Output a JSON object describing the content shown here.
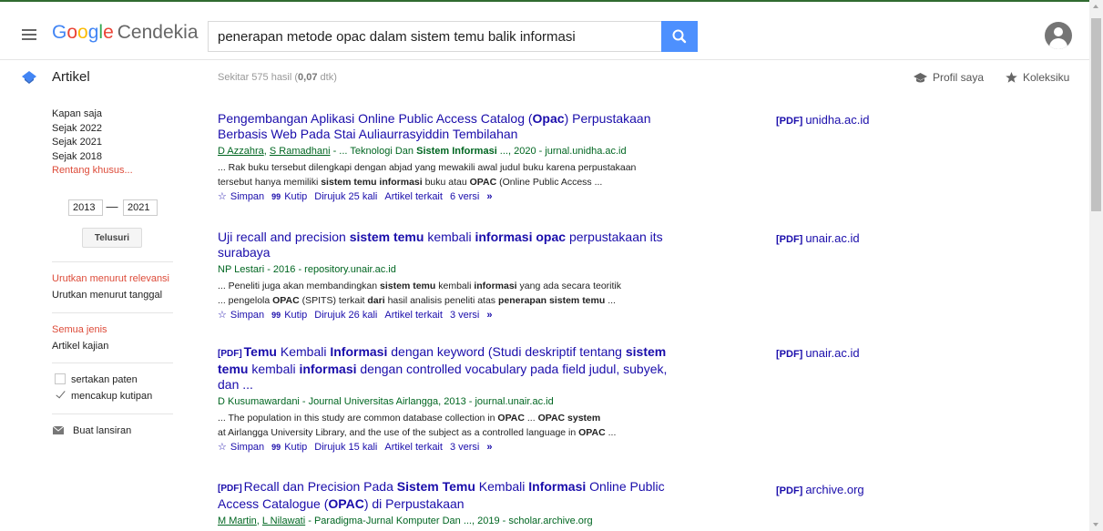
{
  "header": {
    "logo_google": "Google",
    "logo_suffix": "Cendekia",
    "search_value": "penerapan metode opac dalam sistem temu balik informasi"
  },
  "subbar": {
    "section_label": "Artikel",
    "stats_pre": "Sekitar 575 hasil (",
    "stats_time": "0,07",
    "stats_post": " dtk)",
    "profile_label": "Profil saya",
    "library_label": "Koleksiku"
  },
  "sidebar": {
    "time_filters": [
      "Kapan saja",
      "Sejak 2022",
      "Sejak 2021",
      "Sejak 2018",
      "Rentang khusus..."
    ],
    "year_from": "2013",
    "year_to": "2021",
    "range_dash": "—",
    "search_button": "Telusuri",
    "sort_relevance": "Urutkan menurut relevansi",
    "sort_date": "Urutkan menurut tanggal",
    "type_all": "Semua jenis",
    "type_review": "Artikel kajian",
    "include_patents": "sertakan paten",
    "include_citations": "mencakup kutipan",
    "create_alert": "Buat lansiran"
  },
  "common": {
    "pdf_tag": "[PDF]",
    "save": "Simpan",
    "cite": "Kutip",
    "related": "Artikel terkait"
  },
  "results": [
    {
      "title_parts": [
        {
          "t": "Pengembangan Aplikasi Online Public Access Catalog (",
          "b": false
        },
        {
          "t": "Opac",
          "b": true
        },
        {
          "t": ") Perpustakaan Berbasis Web Pada Stai Auliaurrasyiddin Tembilahan",
          "b": false
        }
      ],
      "authors": [
        {
          "t": "D Azzahra",
          "link": true
        },
        {
          "t": ", ",
          "link": false
        },
        {
          "t": "S Ramadhani",
          "link": true
        },
        {
          "t": " - ... Teknologi Dan ",
          "link": false
        },
        {
          "t": "Sistem Informasi",
          "link": false,
          "b": true
        },
        {
          "t": " ..., 2020 - jurnal.unidha.ac.id",
          "link": false
        }
      ],
      "snippet1": [
        {
          "t": "... Rak buku tersebut dilengkapi dengan abjad yang mewakili awal judul buku karena perpustakaan",
          "b": false
        }
      ],
      "snippet2": [
        {
          "t": "tersebut hanya memiliki ",
          "b": false
        },
        {
          "t": "sistem temu informasi",
          "b": true
        },
        {
          "t": " buku atau ",
          "b": false
        },
        {
          "t": "OPAC",
          "b": true
        },
        {
          "t": " (Online Public Access ...",
          "b": false
        }
      ],
      "cited_by": "Dirujuk 25 kali",
      "versions": "6 versi",
      "side_tag": "[PDF]",
      "side_domain": "unidha.ac.id"
    },
    {
      "title_parts": [
        {
          "t": "Uji recall and precision ",
          "b": false
        },
        {
          "t": "sistem temu",
          "b": true
        },
        {
          "t": " kembali ",
          "b": false
        },
        {
          "t": "informasi opac",
          "b": true
        },
        {
          "t": " perpustakaan its surabaya",
          "b": false
        }
      ],
      "authors": [
        {
          "t": "NP Lestari - 2016 - repository.unair.ac.id",
          "link": false
        }
      ],
      "snippet1": [
        {
          "t": "... Peneliti juga akan membandingkan ",
          "b": false
        },
        {
          "t": "sistem temu",
          "b": true
        },
        {
          "t": " kembali ",
          "b": false
        },
        {
          "t": "informasi",
          "b": true
        },
        {
          "t": " yang ada secara teoritik",
          "b": false
        }
      ],
      "snippet2": [
        {
          "t": "... pengelola ",
          "b": false
        },
        {
          "t": "OPAC",
          "b": true
        },
        {
          "t": " (SPITS) terkait ",
          "b": false
        },
        {
          "t": "dari",
          "b": true
        },
        {
          "t": " hasil analisis peneliti atas ",
          "b": false
        },
        {
          "t": "penerapan sistem temu",
          "b": true
        },
        {
          "t": " ...",
          "b": false
        }
      ],
      "cited_by": "Dirujuk 26 kali",
      "versions": "3 versi",
      "side_tag": "[PDF]",
      "side_domain": "unair.ac.id"
    },
    {
      "pdf": true,
      "title_parts": [
        {
          "t": "Temu",
          "b": true
        },
        {
          "t": " Kembali ",
          "b": false
        },
        {
          "t": "Informasi",
          "b": true
        },
        {
          "t": " dengan keyword (Studi deskriptif tentang ",
          "b": false
        },
        {
          "t": "sistem temu",
          "b": true
        },
        {
          "t": " kembali ",
          "b": false
        },
        {
          "t": "informasi",
          "b": true
        },
        {
          "t": " dengan controlled vocabulary pada field judul, subyek, dan ...",
          "b": false
        }
      ],
      "authors": [
        {
          "t": "D Kusumawardani - Journal Universitas Airlangga, 2013 - journal.unair.ac.id",
          "link": false
        }
      ],
      "snippet1": [
        {
          "t": "... The population in this study are common database collection in ",
          "b": false
        },
        {
          "t": "OPAC",
          "b": true
        },
        {
          "t": " ... ",
          "b": false
        },
        {
          "t": "OPAC system",
          "b": true
        }
      ],
      "snippet2": [
        {
          "t": "at Airlangga University Library, and the use of the subject as a controlled language in ",
          "b": false
        },
        {
          "t": "OPAC",
          "b": true
        },
        {
          "t": " ...",
          "b": false
        }
      ],
      "cited_by": "Dirujuk 15 kali",
      "versions": "3 versi",
      "side_tag": "[PDF]",
      "side_domain": "unair.ac.id"
    },
    {
      "pdf": true,
      "title_parts": [
        {
          "t": "Recall dan Precision Pada ",
          "b": false
        },
        {
          "t": "Sistem Temu",
          "b": true
        },
        {
          "t": " Kembali ",
          "b": false
        },
        {
          "t": "Informasi",
          "b": true
        },
        {
          "t": " Online Public Access Catalogue (",
          "b": false
        },
        {
          "t": "OPAC",
          "b": true
        },
        {
          "t": ") di Perpustakaan",
          "b": false
        }
      ],
      "authors": [
        {
          "t": "M Martin",
          "link": true
        },
        {
          "t": ", ",
          "link": false
        },
        {
          "t": "L Nilawati",
          "link": true
        },
        {
          "t": " - Paradigma-Jurnal Komputer Dan ..., 2019 - scholar.archive.org",
          "link": false
        }
      ],
      "side_tag": "[PDF]",
      "side_domain": "archive.org"
    }
  ],
  "icons": {
    "menu": "hamburger-icon",
    "search": "search-icon",
    "avatar": "account-icon",
    "articles": "scholar-cap-icon",
    "profile": "graduation-cap-icon",
    "library": "star-icon",
    "save": "star-outline-icon",
    "cite": "quote-icon",
    "more": "double-chevron-icon",
    "alert": "envelope-icon"
  },
  "colors": {
    "link": "#1a0dab",
    "green": "#006621",
    "selected": "#dd4b39",
    "search_button": "#4d90fe"
  }
}
